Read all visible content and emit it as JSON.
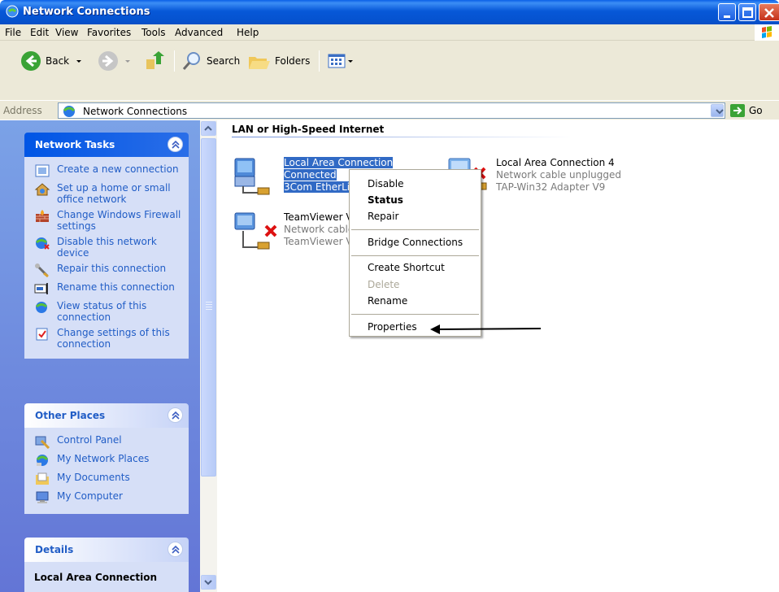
{
  "window": {
    "title": "Network Connections"
  },
  "menu": [
    "File",
    "Edit",
    "View",
    "Favorites",
    "Tools",
    "Advanced",
    "Help"
  ],
  "toolbar": {
    "back": "Back",
    "search": "Search",
    "folders": "Folders"
  },
  "address": {
    "label": "Address",
    "value": "Network Connections",
    "go": "Go"
  },
  "network_tasks": {
    "title": "Network Tasks",
    "items": [
      {
        "label": "Create a new connection",
        "icon": "new-connection-icon"
      },
      {
        "label": "Set up a home or small office network",
        "icon": "home-network-icon"
      },
      {
        "label": "Change Windows Firewall settings",
        "icon": "firewall-icon"
      },
      {
        "label": "Disable this network device",
        "icon": "disable-icon"
      },
      {
        "label": "Repair this connection",
        "icon": "repair-icon"
      },
      {
        "label": "Rename this connection",
        "icon": "rename-icon"
      },
      {
        "label": "View status of this connection",
        "icon": "status-icon"
      },
      {
        "label": "Change settings of this connection",
        "icon": "settings-icon"
      }
    ]
  },
  "other_places": {
    "title": "Other Places",
    "items": [
      {
        "label": "Control Panel",
        "icon": "control-panel-icon"
      },
      {
        "label": "My Network Places",
        "icon": "network-places-icon"
      },
      {
        "label": "My Documents",
        "icon": "documents-icon"
      },
      {
        "label": "My Computer",
        "icon": "computer-icon"
      }
    ]
  },
  "details": {
    "title": "Details",
    "selected_name": "Local Area Connection"
  },
  "main": {
    "group_title": "LAN or High-Speed Internet",
    "connections": [
      {
        "name": "Local Area Connection",
        "status": "Connected",
        "device": "3Com EtherLin",
        "selected": true
      },
      {
        "name": "Local Area Connection 4",
        "status": "Network cable unplugged",
        "device": "TAP-Win32 Adapter V9"
      },
      {
        "name": "TeamViewer V",
        "status": "Network cable",
        "device": "TeamViewer V"
      }
    ]
  },
  "context_menu": {
    "items": [
      "Disable",
      "Status",
      "Repair",
      "Bridge Connections",
      "Create Shortcut",
      "Delete",
      "Rename",
      "Properties"
    ]
  },
  "colors": {
    "xp_blue": "#0553d0",
    "task_link": "#215dc6",
    "selection": "#316ac5",
    "panel_body": "#d6dff7"
  }
}
